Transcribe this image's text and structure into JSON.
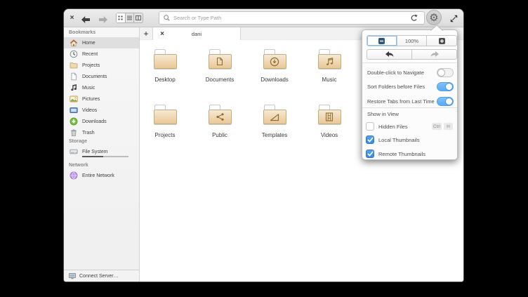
{
  "toolbar": {
    "close_label": "×",
    "search_placeholder": "Search or Type Path",
    "view_modes": [
      "grid",
      "list",
      "column"
    ],
    "view_selected": "grid"
  },
  "sidebar": {
    "sections": [
      {
        "header": "Bookmarks",
        "items": [
          {
            "icon": "home",
            "label": "Home",
            "selected": true
          },
          {
            "icon": "recent",
            "label": "Recent"
          },
          {
            "icon": "folder",
            "label": "Projects"
          },
          {
            "icon": "document",
            "label": "Documents"
          },
          {
            "icon": "music",
            "label": "Music"
          },
          {
            "icon": "pictures",
            "label": "Pictures"
          },
          {
            "icon": "videos",
            "label": "Videos"
          },
          {
            "icon": "downloads",
            "label": "Downloads"
          },
          {
            "icon": "trash",
            "label": "Trash"
          }
        ]
      },
      {
        "header": "Storage",
        "items": [
          {
            "icon": "filesystem",
            "label": "File System",
            "usage_pct": 45
          }
        ]
      },
      {
        "header": "Network",
        "items": [
          {
            "icon": "network",
            "label": "Entire Network"
          }
        ]
      }
    ],
    "connect_label": "Connect Server…"
  },
  "tabs": {
    "new_tab_label": "+",
    "active": {
      "close_label": "×",
      "title": "dani"
    }
  },
  "folders": [
    {
      "emblem": "none",
      "label": "Desktop"
    },
    {
      "emblem": "doc",
      "label": "Documents"
    },
    {
      "emblem": "download",
      "label": "Downloads"
    },
    {
      "emblem": "music",
      "label": "Music"
    },
    {
      "emblem": "none",
      "label": "Projects"
    },
    {
      "emblem": "share",
      "label": "Public"
    },
    {
      "emblem": "triangle",
      "label": "Templates"
    },
    {
      "emblem": "film",
      "label": "Videos"
    }
  ],
  "popover": {
    "zoom": {
      "out_label": "−",
      "value": "100%",
      "in_label": "+"
    },
    "switch_rows": [
      {
        "label": "Double-click to Navigate",
        "on": false
      },
      {
        "label": "Sort Folders before Files",
        "on": true
      },
      {
        "label": "Restore Tabs from Last Time",
        "on": true
      }
    ],
    "section_header": "Show in View",
    "check_rows": [
      {
        "label": "Hidden Files",
        "checked": false,
        "shortcut": [
          "Ctrl",
          "H"
        ]
      },
      {
        "label": "Local Thumbnails",
        "checked": true
      },
      {
        "label": "Remote Thumbnails",
        "checked": true
      }
    ],
    "colors": {
      "accent": "#3689e6",
      "toggle_on": "#64b3f9"
    }
  }
}
